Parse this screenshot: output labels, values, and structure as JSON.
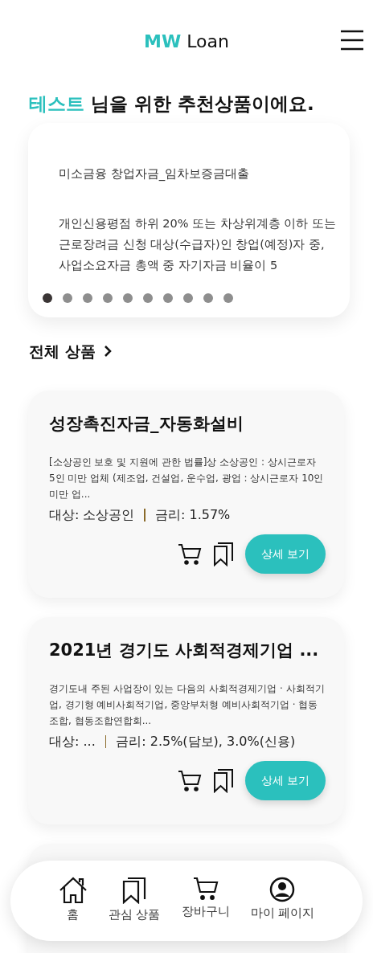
{
  "header": {
    "logo_accent": "MW",
    "logo_text": "Loan"
  },
  "greeting": {
    "name": "테스트",
    "text": "님을 위한 추천상품이에요."
  },
  "recommendation": {
    "title": "미소금융 창업자금_임차보증금대출",
    "description": "개인신용평점 하위 20% 또는 차상위계층 이하 또는 근로장려금 신청 대상(수급자)인 창업(예정)자 중, 사업소요자금 총액 중 자기자금 비율이 5",
    "dots": [
      {
        "selected": true
      },
      {
        "selected": false
      },
      {
        "selected": false
      },
      {
        "selected": false
      },
      {
        "selected": false
      },
      {
        "selected": false
      },
      {
        "selected": false
      },
      {
        "selected": false
      },
      {
        "selected": false
      },
      {
        "selected": false
      }
    ]
  },
  "all_products_link": "전체 상품",
  "products": [
    {
      "title": "성장촉진자금_자동화설비",
      "description": "[소상공인 보호 및 지원에 관한 법률]상 소상공인 : 상시근로자 5인 미만 업체 (제조업, 건설업, 운수업, 광업 : 상시근로자 10인 미만 업...",
      "target": "대상: 소상공인",
      "rate": "금리: 1.57%",
      "button": "상세 보기"
    },
    {
      "title": "2021년 경기도 사회적경제기업 ...",
      "description": "경기도내 주된 사업장이 있는 다음의 사회적경제기업 · 사회적기업, 경기형 예비사회적기업, 중앙부처형 예비사회적기업 · 협동조합, 협동조합연합회...",
      "target": "대상: ...",
      "rate": "금리: 2.5%(담보), 3.0%(신용)",
      "button": "상세 보기"
    }
  ],
  "bottom_nav": [
    {
      "kind": "home",
      "label": "홈"
    },
    {
      "kind": "bookmarks",
      "label": "관심 상품"
    },
    {
      "kind": "cart",
      "label": "장바구니"
    },
    {
      "kind": "profile",
      "label": "마이 페이지"
    }
  ]
}
